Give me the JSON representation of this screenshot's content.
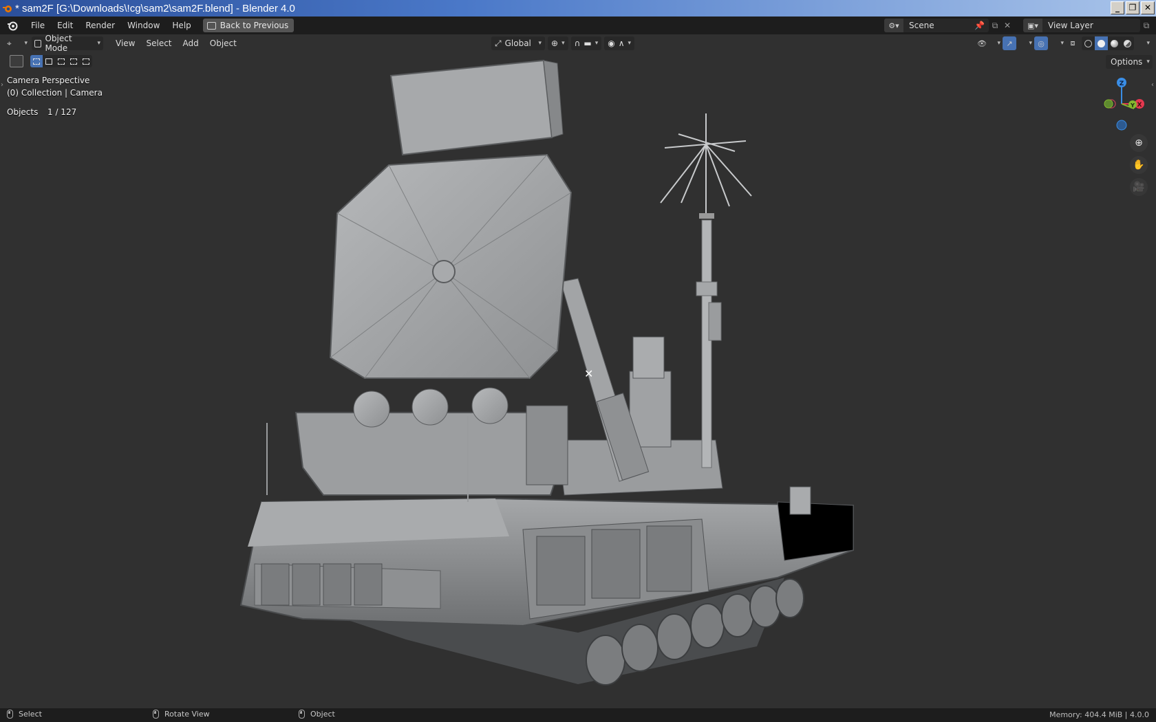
{
  "window": {
    "title": "* sam2F [G:\\Downloads\\!cg\\sam2\\sam2F.blend] - Blender 4.0",
    "minimize": "_",
    "restore": "❐",
    "close": "✕"
  },
  "topbar": {
    "menus": [
      "File",
      "Edit",
      "Render",
      "Window",
      "Help"
    ],
    "back_button": "Back to Previous",
    "scene_label": "Scene",
    "view_layer_label": "View Layer"
  },
  "viewport_header": {
    "mode": "Object Mode",
    "menus": [
      "View",
      "Select",
      "Add",
      "Object"
    ],
    "transform_orientation": "Global",
    "options": "Options"
  },
  "overlay": {
    "camera": "Camera Perspective",
    "collection": "(0) Collection | Camera",
    "objects_label": "Objects",
    "objects_count": "1 / 127"
  },
  "gizmo": {
    "z": "Z",
    "x": "X",
    "y": "Y"
  },
  "statusbar": {
    "select": "Select",
    "rotate": "Rotate View",
    "object": "Object",
    "memory": "Memory: 404.4 MiB | 4.0.0"
  },
  "colors": {
    "accent": "#4772b3",
    "viewport_bg": "#3d3d3d",
    "header_bg": "#303030",
    "topbar_bg": "#1d1d1d",
    "axis_x": "#e5384f",
    "axis_y": "#84b82f",
    "axis_z": "#3a8ee6"
  }
}
